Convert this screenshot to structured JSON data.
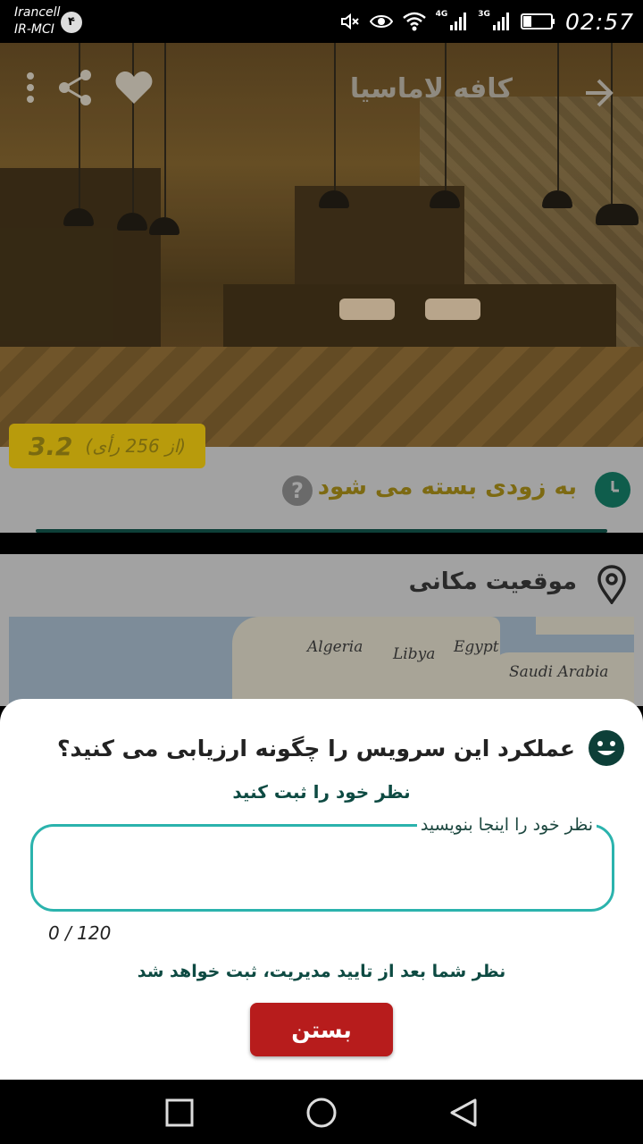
{
  "status_bar": {
    "carrier_line1": "Irancell",
    "carrier_line2": "IR-MCI",
    "sim_badge": "۴",
    "net1_label": "4G",
    "net2_label": "3G",
    "time": "02:57",
    "battery_level": 0.3
  },
  "app_bar": {
    "title": "کافه لاماسیا",
    "icons": [
      "back-arrow-icon",
      "heart-icon",
      "share-icon",
      "more-vert-icon"
    ]
  },
  "rating": {
    "score": "3.2",
    "votes_text": "(از 256 رأی)"
  },
  "status_card": {
    "text": "به زودی بسته می شود",
    "help_symbol": "?"
  },
  "location_card": {
    "title": "موقعیت مکانی",
    "map_labels": [
      "Algeria",
      "Libya",
      "Egypt",
      "Saudi Arabia"
    ]
  },
  "dialog": {
    "question": "عملکرد این سرویس را چگونه ارزیابی می کنید؟",
    "prompt": "نظر خود را ثبت کنید",
    "comment_label": "نظر خود را اینجا بنویسید",
    "comment_value": "",
    "counter": "0 / 120",
    "note": "نظر شما بعد از تایید مدیریت، ثبت خواهد شد",
    "close_label": "بستن"
  },
  "colors": {
    "accent_teal": "#2bb3ad",
    "dark_teal": "#0d4a42",
    "close_red": "#b71c1c",
    "rating_gold": "#b89b0c"
  }
}
